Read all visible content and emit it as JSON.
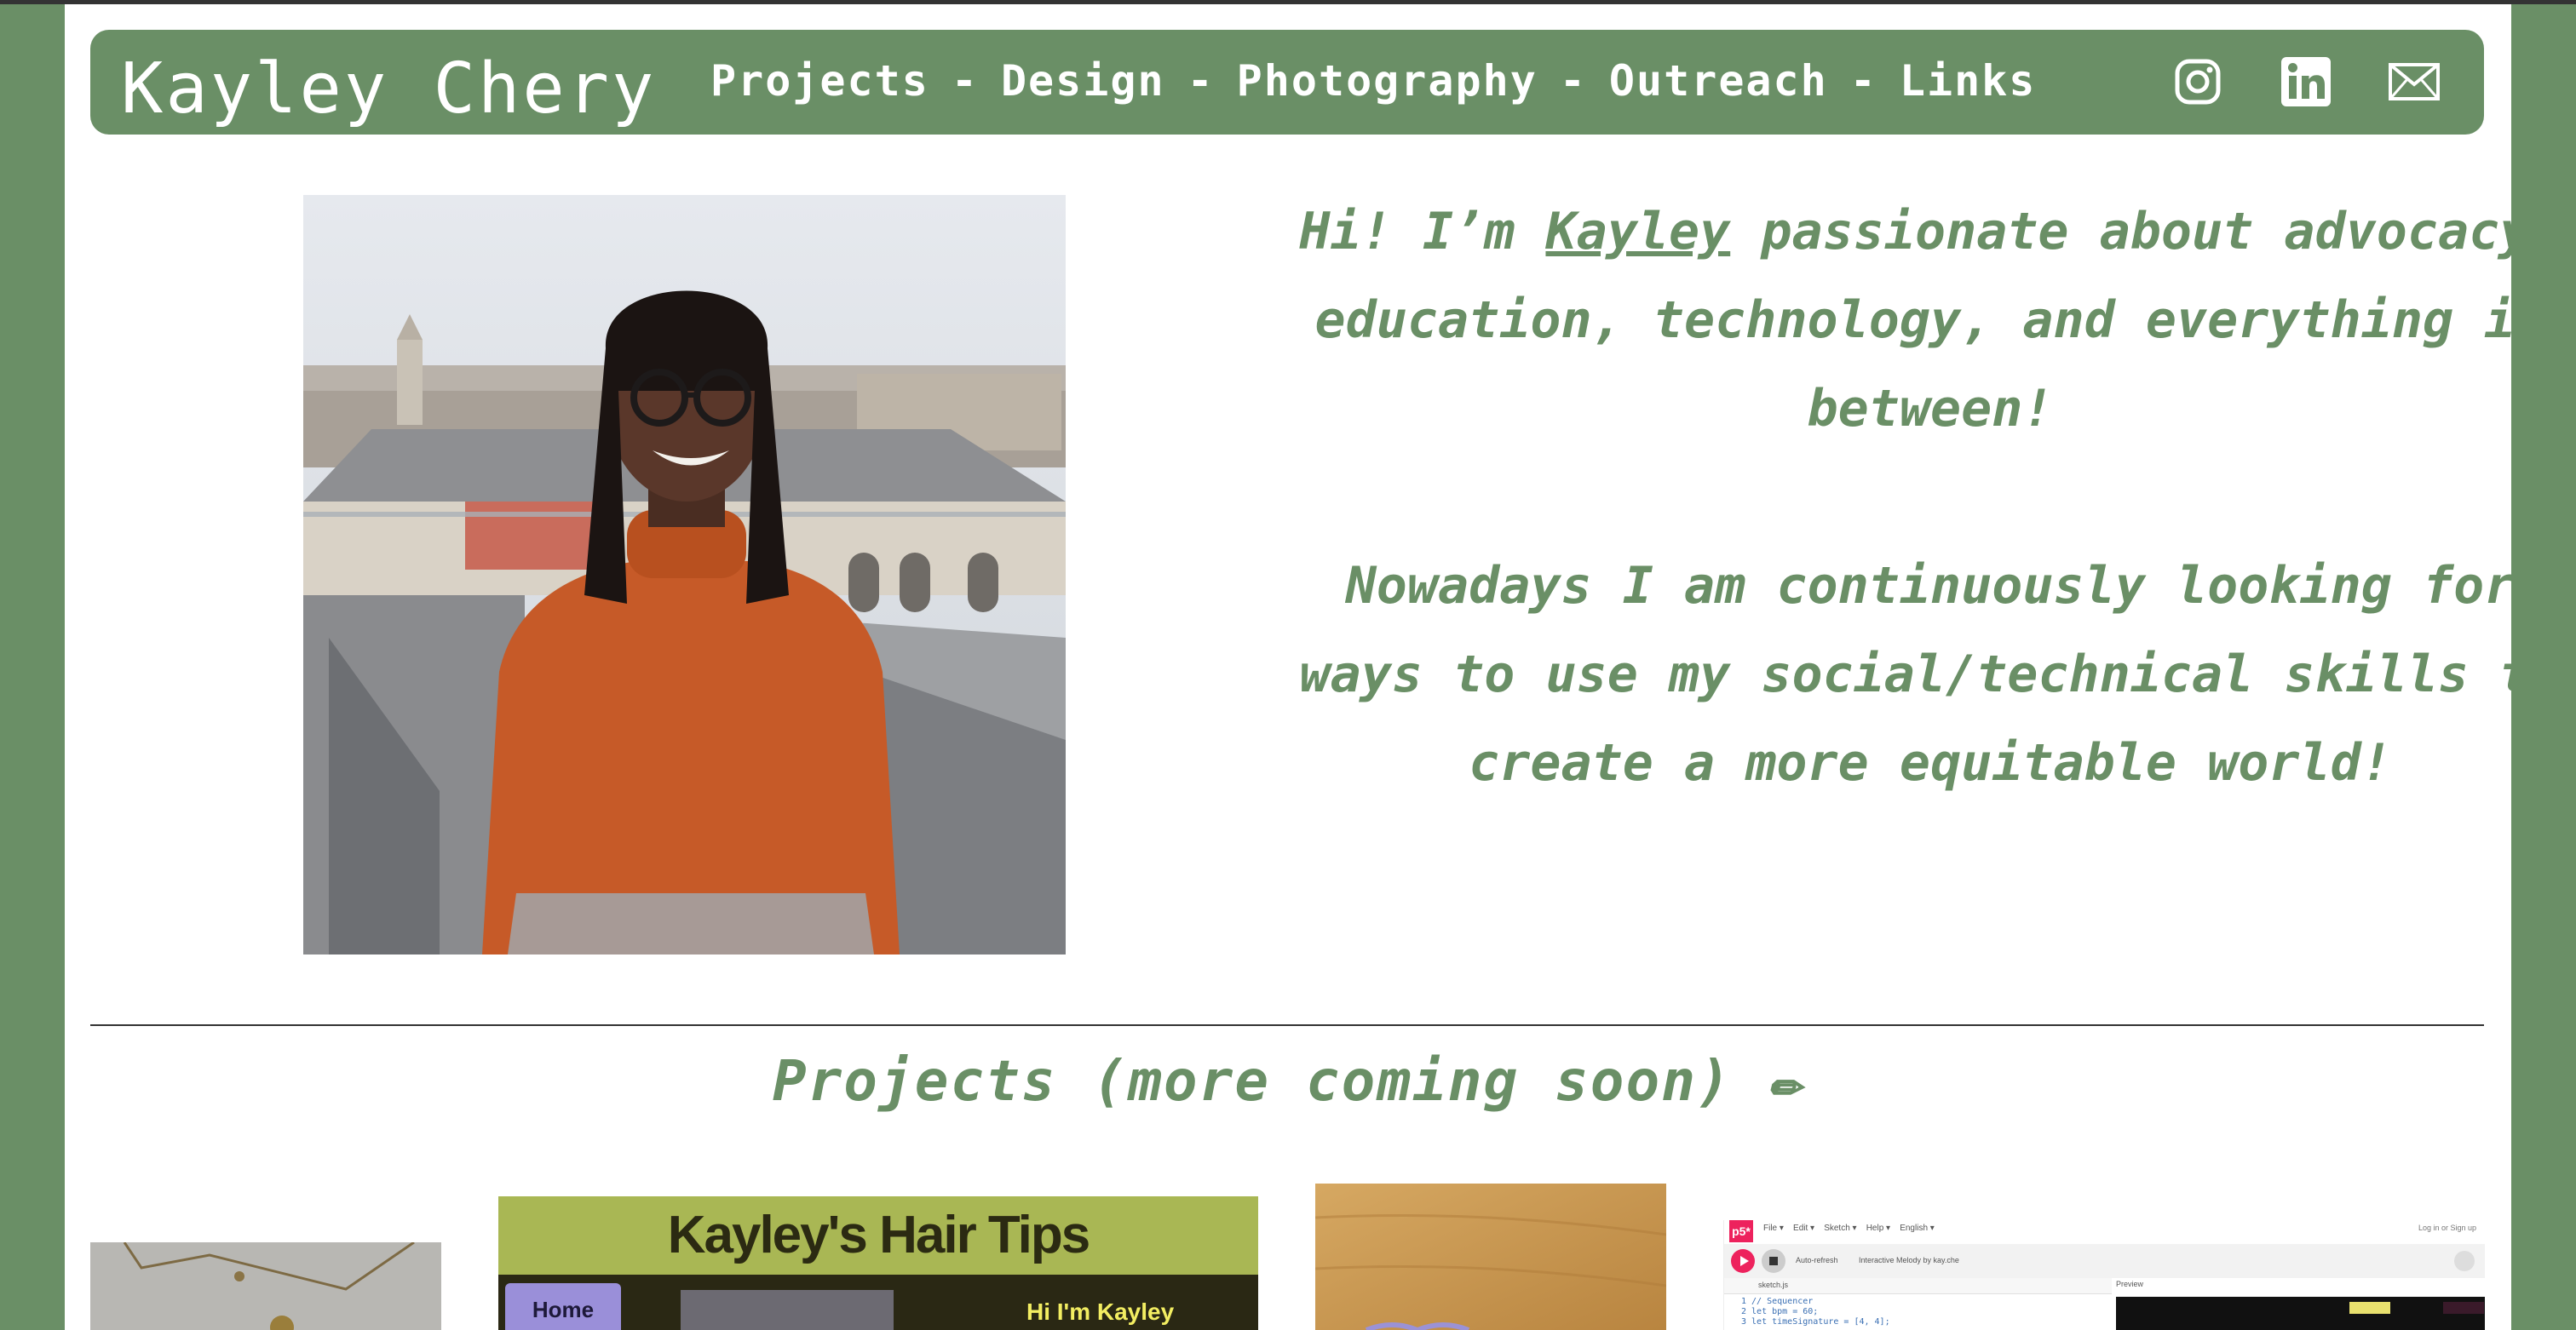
{
  "header": {
    "brand": "Kayley Chery",
    "nav": [
      {
        "label": "Projects"
      },
      {
        "label": "Design"
      },
      {
        "label": "Photography"
      },
      {
        "label": "Outreach"
      },
      {
        "label": "Links"
      }
    ],
    "separator": "-",
    "social": [
      {
        "icon": "instagram-icon"
      },
      {
        "icon": "linkedin-icon"
      },
      {
        "icon": "mail-icon"
      }
    ]
  },
  "hero": {
    "intro_before": "Hi! I’m ",
    "intro_name": "Kayley",
    "intro_after": " passionate about advocacy, education, technology, and everything in between!",
    "paragraph2": "Nowadays I am continuously looking for ways to use my social/technical skills to create a more equitable world!"
  },
  "projects": {
    "heading": "Projects (more coming soon) ✏",
    "hair_tips": {
      "title": "Kayley's Hair Tips",
      "home": "Home",
      "greeting": "Hi I'm Kayley"
    },
    "p5": {
      "logo": "p5*",
      "menu": [
        "File ▾",
        "Edit ▾",
        "Sketch ▾",
        "Help ▾",
        "English ▾"
      ],
      "auth": "Log in  or  Sign up",
      "auto_refresh": "Auto-refresh",
      "sketch_name": "Interactive Melody by kay.che",
      "file_name": "sketch.js",
      "preview": "Preview",
      "code": [
        "1   // Sequencer",
        "2   let bpm = 60;",
        "3   let timeSignature = [4, 4];"
      ]
    }
  },
  "colors": {
    "accent_green": "#6a8f66",
    "page_bg": "#ffffff"
  }
}
